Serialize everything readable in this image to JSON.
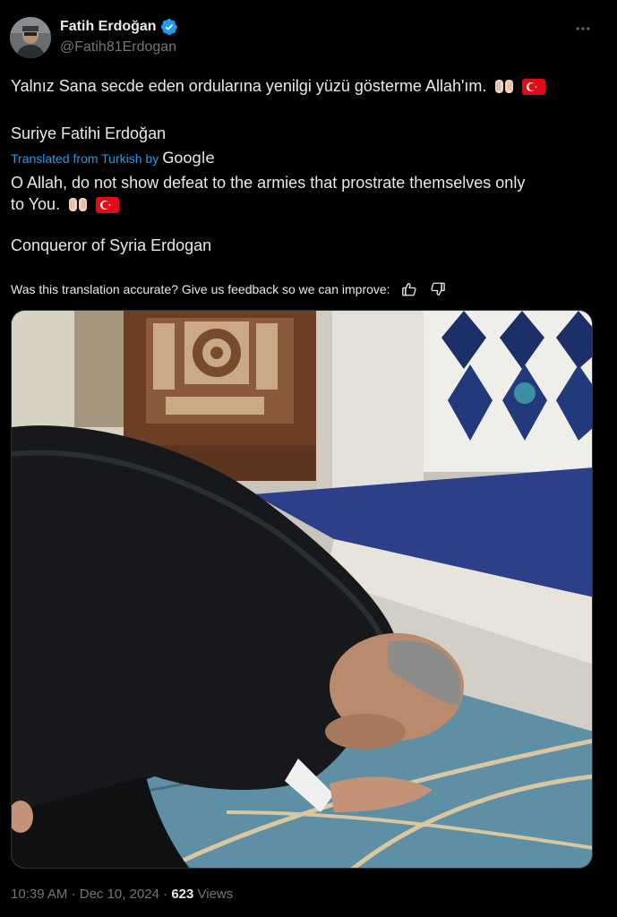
{
  "author": {
    "display_name": "Fatih Erdoğan",
    "handle": "@Fatih81Erdogan",
    "verified": true
  },
  "tweet": {
    "original_text": "Yalnız Sana secde eden ordularına yenilgi yüzü gösterme Allah'ım.",
    "original_text_line2": "Suriye Fatihi Erdoğan",
    "translated_label": "Translated from Turkish by",
    "translator_brand": "Google",
    "translated_line1": "O Allah, do not show defeat to the armies that prostrate themselves only",
    "translated_line2": "to You.",
    "translated_line3": "Conqueror of Syria Erdogan",
    "feedback_prompt": "Was this translation accurate? Give us feedback so we can improve:"
  },
  "footer": {
    "time": "10:39 AM",
    "separator": "·",
    "date": "Dec 10, 2024",
    "views_count": "623",
    "views_label": "Views"
  },
  "icons": {
    "verified": "verified-badge-icon",
    "more": "more-horizontal-icon",
    "hands": "praying-hands-emoji",
    "flag": "turkey-flag-emoji",
    "thumbs_up": "thumbs-up-icon",
    "thumbs_down": "thumbs-down-icon"
  },
  "colors": {
    "background": "#000000",
    "primary_text": "#e7e9ea",
    "secondary_text": "#71767b",
    "link_blue": "#1d9bf0",
    "verified_blue": "#1d9bf0",
    "flag_red": "#e30a17"
  }
}
